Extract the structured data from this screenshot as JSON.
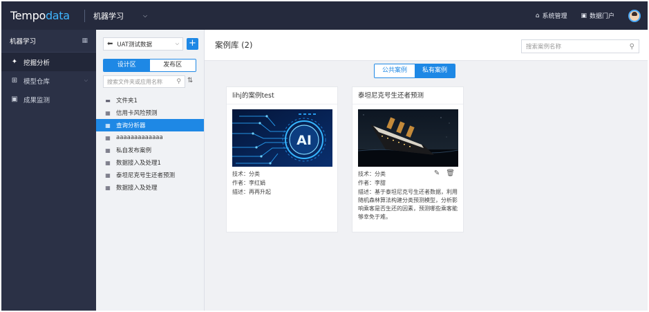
{
  "header": {
    "logo_prefix": "Tempo",
    "logo_suffix": "data",
    "module": "机器学习",
    "links": [
      {
        "icon": "home-icon",
        "label": "系统管理"
      },
      {
        "icon": "monitor-icon",
        "label": "数据门户"
      }
    ]
  },
  "sidebar": {
    "title": "机器学习",
    "items": [
      {
        "label": "挖掘分析",
        "icon": "mining-icon",
        "active": true
      },
      {
        "label": "模型仓库",
        "icon": "model-repo-icon",
        "active": false
      },
      {
        "label": "成果监测",
        "icon": "monitor-icon",
        "active": false
      }
    ]
  },
  "panel": {
    "dataset": "UAT测试数据",
    "add_label": "+",
    "tabs": [
      "设计区",
      "发布区"
    ],
    "search_placeholder": "搜索文件夹或应用名称",
    "tree": [
      {
        "label": "文件夹1",
        "type": "folder"
      },
      {
        "label": "信用卡风险预测",
        "type": "app"
      },
      {
        "label": "查询分析器",
        "type": "app",
        "selected": true
      },
      {
        "label": "aaaaaaaaaaaaa",
        "type": "app"
      },
      {
        "label": "私自发布案例",
        "type": "app"
      },
      {
        "label": "数据接入及处理1",
        "type": "app"
      },
      {
        "label": "泰坦尼克号生还者预测",
        "type": "app"
      },
      {
        "label": "数据接入及处理",
        "type": "app"
      }
    ]
  },
  "main": {
    "title": "案例库 (2)",
    "search_placeholder": "搜索案例名称",
    "tabs": [
      "公共案例",
      "私有案例"
    ],
    "cards": [
      {
        "title": "lihj的案例test",
        "tech": "技术：分类",
        "author": "作者：李红娟",
        "desc": "描述：再再升起",
        "image_text": "AI"
      },
      {
        "title": "泰坦尼克号生还者预测",
        "tech": "技术：分类",
        "author": "作者：李甜",
        "desc": "描述：基于泰坦尼克号生还者数据，利用随机森林算法构建分类预测模型，分析影响乘客是否生还的因素，预测哪些乘客能够幸免于难。"
      }
    ]
  },
  "colors": {
    "topbar": "#252a3d",
    "sidebar": "#2b3146",
    "accent": "#1e88e5"
  }
}
